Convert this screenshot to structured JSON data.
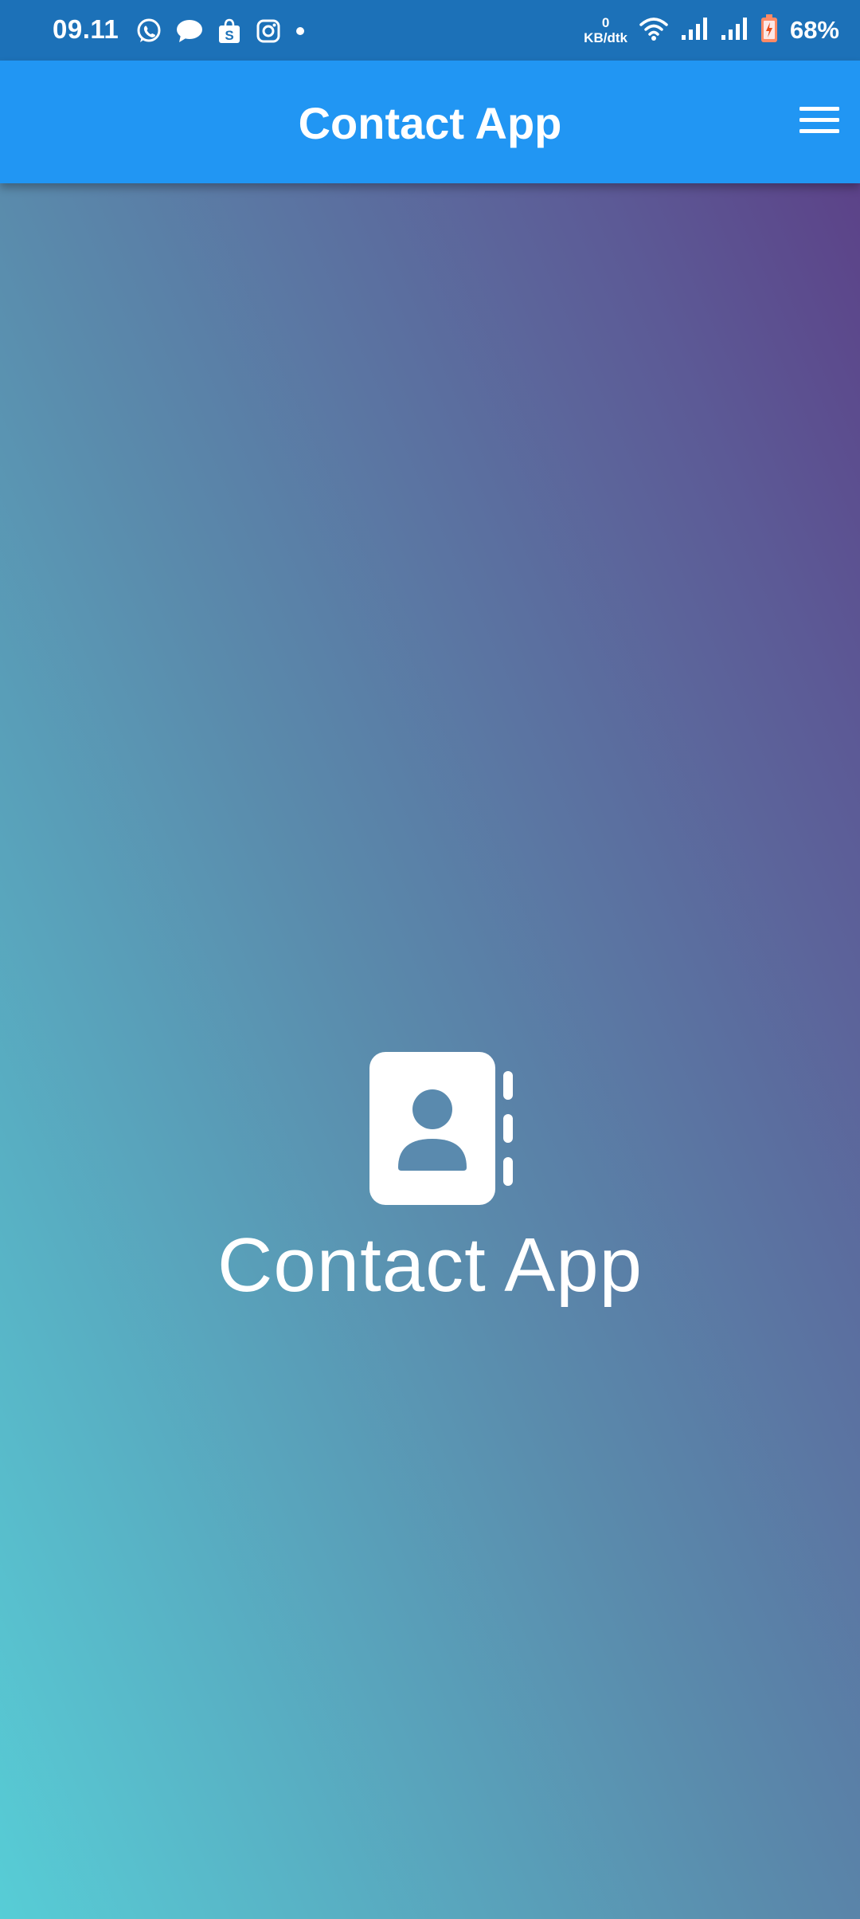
{
  "status_bar": {
    "time": "09.11",
    "net_speed_value": "0",
    "net_speed_unit": "KB/dtk",
    "battery_percent": "68%",
    "notification_icons": [
      "whatsapp-icon",
      "message-bubble-icon",
      "shopping-bag-icon",
      "instagram-icon",
      "dot-icon"
    ],
    "right_icons": [
      "wifi-icon",
      "signal-icon",
      "signal-icon",
      "battery-icon"
    ]
  },
  "app_bar": {
    "title": "Contact App",
    "menu_icon": "hamburger-menu-icon",
    "color": "#2196f3"
  },
  "splash": {
    "icon": "contact-book-icon",
    "title": "Contact App"
  },
  "colors": {
    "status_bar": "#1c71b8",
    "gradient_top_right": "#5c3b84",
    "gradient_bottom_left": "#57cdd6",
    "text": "#ffffff"
  }
}
